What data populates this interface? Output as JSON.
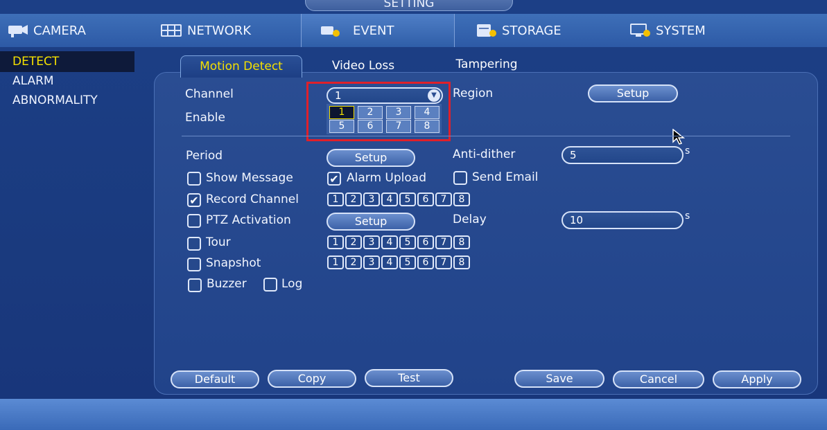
{
  "window": {
    "title": "SETTING"
  },
  "top_tabs": [
    {
      "label": "CAMERA",
      "icon": "camera-icon"
    },
    {
      "label": "NETWORK",
      "icon": "network-icon"
    },
    {
      "label": "EVENT",
      "icon": "event-icon"
    },
    {
      "label": "STORAGE",
      "icon": "storage-icon"
    },
    {
      "label": "SYSTEM",
      "icon": "system-icon"
    }
  ],
  "active_top_tab": "EVENT",
  "sidebar": {
    "items": [
      "DETECT",
      "ALARM",
      "ABNORMALITY"
    ],
    "active": "DETECT"
  },
  "sub_tabs": [
    "Motion Detect",
    "Video Loss",
    "Tampering"
  ],
  "active_sub_tab": "Motion Detect",
  "form": {
    "channel_label": "Channel",
    "channel_value": "1",
    "channel_options": [
      "1",
      "2",
      "3",
      "4",
      "5",
      "6",
      "7",
      "8"
    ],
    "enable_label": "Enable",
    "region_label": "Region",
    "region_button": "Setup",
    "period_label": "Period",
    "period_button": "Setup",
    "anti_dither_label": "Anti-dither",
    "anti_dither_value": "5",
    "anti_dither_unit": "s",
    "show_message_label": "Show Message",
    "show_message_checked": false,
    "alarm_upload_label": "Alarm Upload",
    "alarm_upload_checked": true,
    "send_email_label": "Send Email",
    "send_email_checked": false,
    "record_channel_label": "Record Channel",
    "record_channel_checked": true,
    "record_channels": [
      "1",
      "2",
      "3",
      "4",
      "5",
      "6",
      "7",
      "8"
    ],
    "ptz_label": "PTZ Activation",
    "ptz_checked": false,
    "ptz_button": "Setup",
    "delay_label": "Delay",
    "delay_value": "10",
    "delay_unit": "s",
    "tour_label": "Tour",
    "tour_checked": false,
    "tour_channels": [
      "1",
      "2",
      "3",
      "4",
      "5",
      "6",
      "7",
      "8"
    ],
    "snapshot_label": "Snapshot",
    "snapshot_checked": false,
    "snapshot_channels": [
      "1",
      "2",
      "3",
      "4",
      "5",
      "6",
      "7",
      "8"
    ],
    "buzzer_label": "Buzzer",
    "buzzer_checked": false,
    "log_label": "Log",
    "log_checked": false
  },
  "footer": {
    "default_label": "Default",
    "copy_label": "Copy",
    "test_label": "Test",
    "save_label": "Save",
    "cancel_label": "Cancel",
    "apply_label": "Apply"
  },
  "colors": {
    "accent_yellow": "#f4e000",
    "highlight_red": "#e0202a",
    "panel_blue": "#21438a"
  }
}
